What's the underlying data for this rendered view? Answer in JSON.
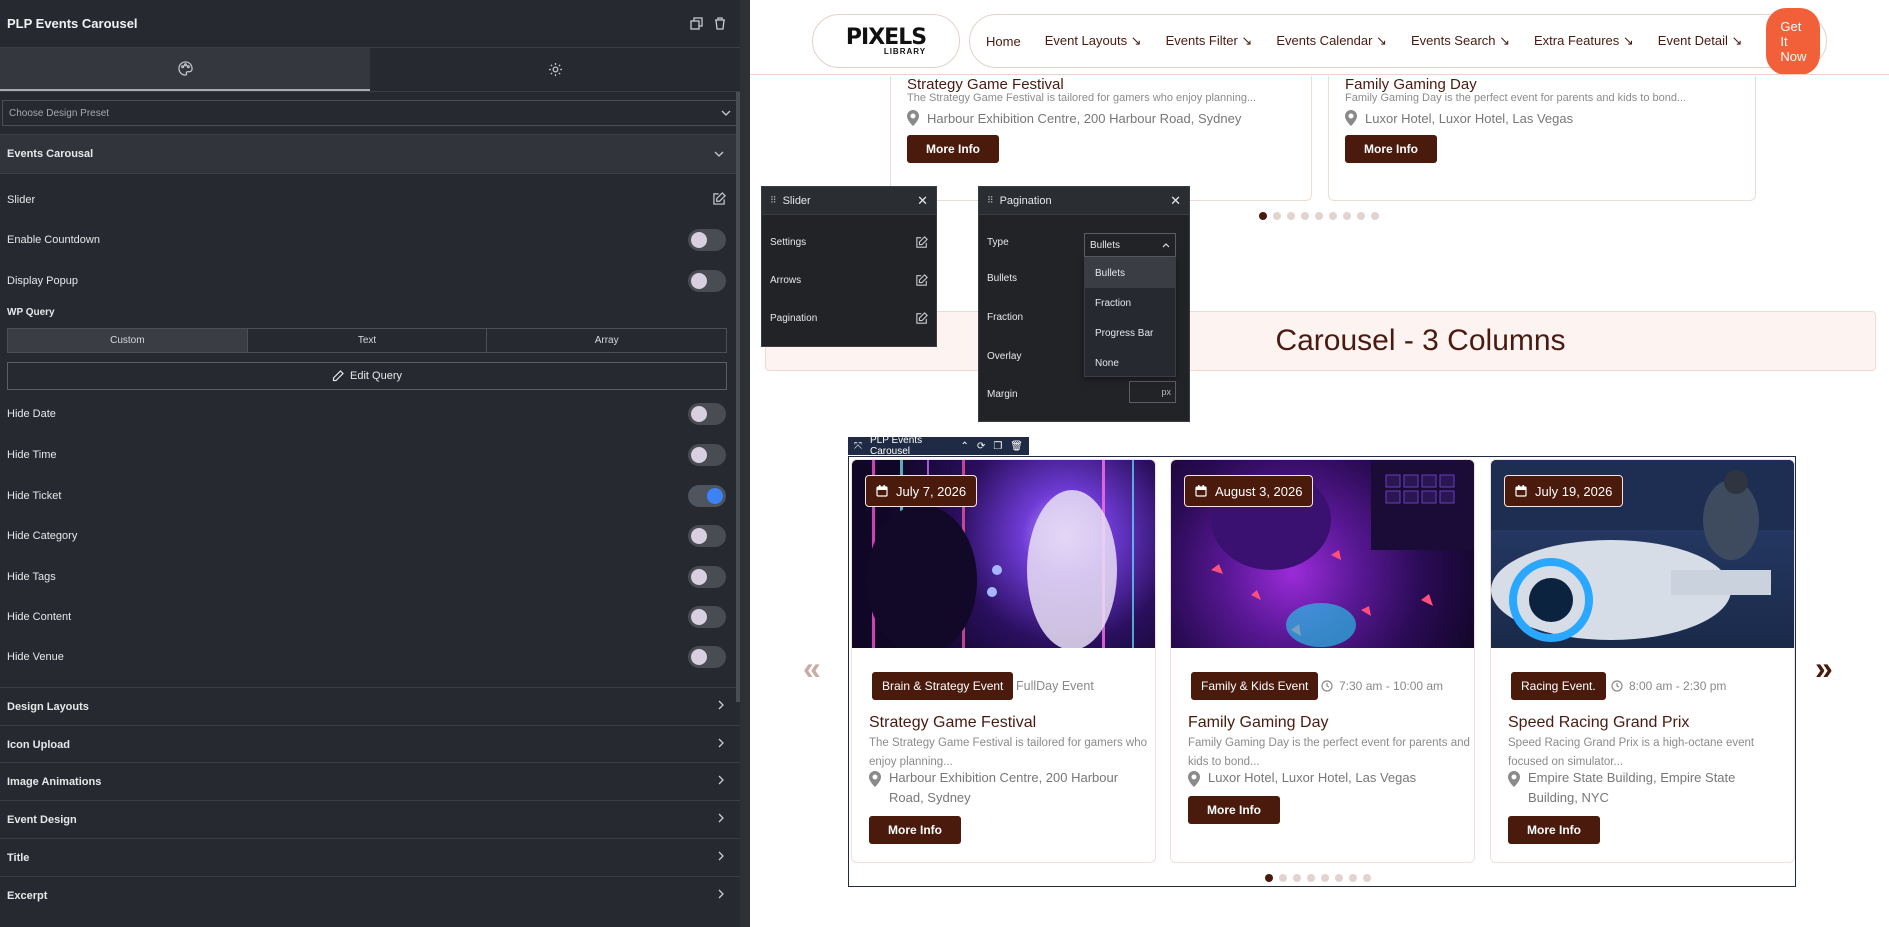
{
  "panel": {
    "title": "PLP Events Carousel",
    "design_preset_placeholder": "Choose Design Preset",
    "section_title": "Events Carousal",
    "slider_label": "Slider",
    "toggles": [
      {
        "label": "Enable Countdown",
        "on": false
      },
      {
        "label": "Display Popup",
        "on": false
      }
    ],
    "wp_query_label": "WP Query",
    "query_modes": [
      "Custom",
      "Text",
      "Array"
    ],
    "edit_query_label": "Edit Query",
    "hide_toggles": [
      {
        "label": "Hide Date",
        "on": false
      },
      {
        "label": "Hide Time",
        "on": false
      },
      {
        "label": "Hide Ticket",
        "on": true
      },
      {
        "label": "Hide Category",
        "on": false
      },
      {
        "label": "Hide Tags",
        "on": false
      },
      {
        "label": "Hide Content",
        "on": false
      },
      {
        "label": "Hide Venue",
        "on": false
      }
    ],
    "collapsed_sections": [
      "Design Layouts",
      "Icon Upload",
      "Image Animations",
      "Event Design",
      "Title",
      "Excerpt"
    ]
  },
  "site": {
    "logo": "PIXELS",
    "logo_sub": "LIBRARY",
    "nav": [
      "Home",
      "Event Layouts ↘",
      "Events Filter ↘",
      "Events Calendar ↘",
      "Events Search ↘",
      "Extra Features ↘",
      "Event Detail ↘"
    ],
    "cta": "Get It Now",
    "top_cards": [
      {
        "title": "Strategy Game Festival",
        "desc": "The Strategy Game Festival is tailored for gamers who enjoy planning...",
        "venue": "Harbour Exhibition Centre, 200 Harbour Road, Sydney",
        "button": "More Info"
      },
      {
        "title": "Family Gaming Day",
        "desc": "Family Gaming Day is the perfect event for parents and kids to bond...",
        "venue": "Luxor Hotel, Luxor Hotel, Las Vegas",
        "button": "More Info"
      }
    ],
    "section_title": "Carousel - 3 Columns",
    "widget_label": "PLP Events Carousel",
    "cards": [
      {
        "date": "July 7, 2026",
        "category": "Brain & Strategy Event",
        "time": "FullDay Event",
        "title": "Strategy Game Festival",
        "desc": "The Strategy Game Festival is tailored for gamers who enjoy planning...",
        "venue": "Harbour Exhibition Centre, 200 Harbour Road, Sydney",
        "button": "More Info"
      },
      {
        "date": "August 3, 2026",
        "category": "Family & Kids Event",
        "time": "7:30 am - 10:00 am",
        "title": "Family Gaming Day",
        "desc": "Family Gaming Day is the perfect event for parents and kids to bond...",
        "venue": "Luxor Hotel, Luxor Hotel, Las Vegas",
        "button": "More Info"
      },
      {
        "date": "July 19, 2026",
        "category": "Racing Event.",
        "time": "8:00 am - 2:30 pm",
        "title": "Speed Racing Grand Prix",
        "desc": "Speed Racing Grand Prix is a high-octane event focused on simulator...",
        "venue": "Empire State Building, Empire State Building, NYC",
        "button": "More Info"
      }
    ]
  },
  "slider_popup": {
    "title": "Slider",
    "items": [
      "Settings",
      "Arrows",
      "Pagination"
    ]
  },
  "pagination_popup": {
    "title": "Pagination",
    "type_label": "Type",
    "type_value": "Bullets",
    "rows": [
      "Bullets",
      "Fraction",
      "Overlay",
      "Margin"
    ],
    "options": [
      "Bullets",
      "Fraction",
      "Progress Bar",
      "None"
    ],
    "margin_unit": "px"
  },
  "colors": {
    "brand": "#4a1a0c",
    "cta": "#f2603a",
    "panel_bg": "#26292f",
    "toggle_on": "#3b82f6"
  }
}
